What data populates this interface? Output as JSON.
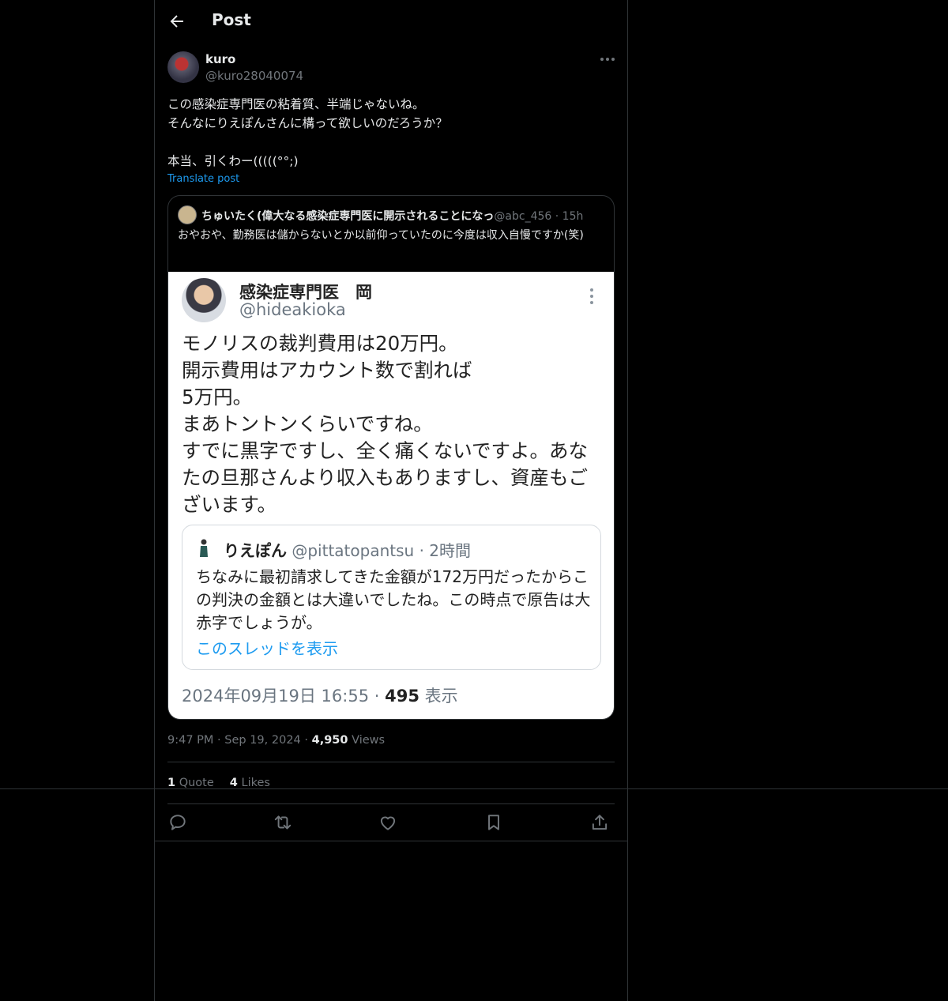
{
  "header": {
    "title": "Post"
  },
  "post": {
    "author_name": "kuro",
    "author_handle": "@kuro28040074",
    "text": "この感染症専門医の粘着質、半端じゃないね。\nそんなにりえぽんさんに構って欲しいのだろうか？\n\n本当、引くわー(((((°°;)",
    "translate_label": "Translate post",
    "time": "9:47 PM",
    "sep": "·",
    "date": "Sep 19, 2024",
    "views_count": "4,950",
    "views_label": "Views",
    "quotes_count": "1",
    "quotes_label": "Quote",
    "likes_count": "4",
    "likes_label": "Likes"
  },
  "quoted": {
    "name": "ちゅいたく(偉大なる感染症専門医に開示されることになっ",
    "handle": "@abc_456",
    "sep": "·",
    "time": "15h",
    "text": "おやおや、勤務医は儲からないとか以前仰っていたのに今度は収入自慢ですか(笑)"
  },
  "screenshot": {
    "name": "感染症専門医　岡",
    "handle": "@hideakioka",
    "body": "モノリスの裁判費用は20万円。\n開示費用はアカウント数で割れば\n5万円。\nまあトントンくらいですね。\nすでに黒字ですし、全く痛くないですよ。あなたの旦那さんより収入もありますし、資産もございます。",
    "quote_name": "りえぽん",
    "quote_handle": "@pittatopantsu",
    "quote_time": "· 2時間",
    "quote_text": "ちなみに最初請求してきた金額が172万円だったからこの判決の金額とは大違いでしたね。この時点で原告は大赤字でしょうが。",
    "quote_link": "このスレッドを表示",
    "meta_date": "2024年09月19日 16:55 · ",
    "meta_views": "495",
    "meta_views_label": " 表示"
  },
  "icons": {
    "back": "arrow-left-icon",
    "more": "more-horizontal-icon",
    "reply": "reply-icon",
    "repost": "repost-icon",
    "like": "heart-icon",
    "bookmark": "bookmark-icon",
    "share": "share-icon"
  },
  "colors": {
    "background": "#000000",
    "accent": "#1d9bf0",
    "muted": "#71767b",
    "border": "#2f3336"
  }
}
